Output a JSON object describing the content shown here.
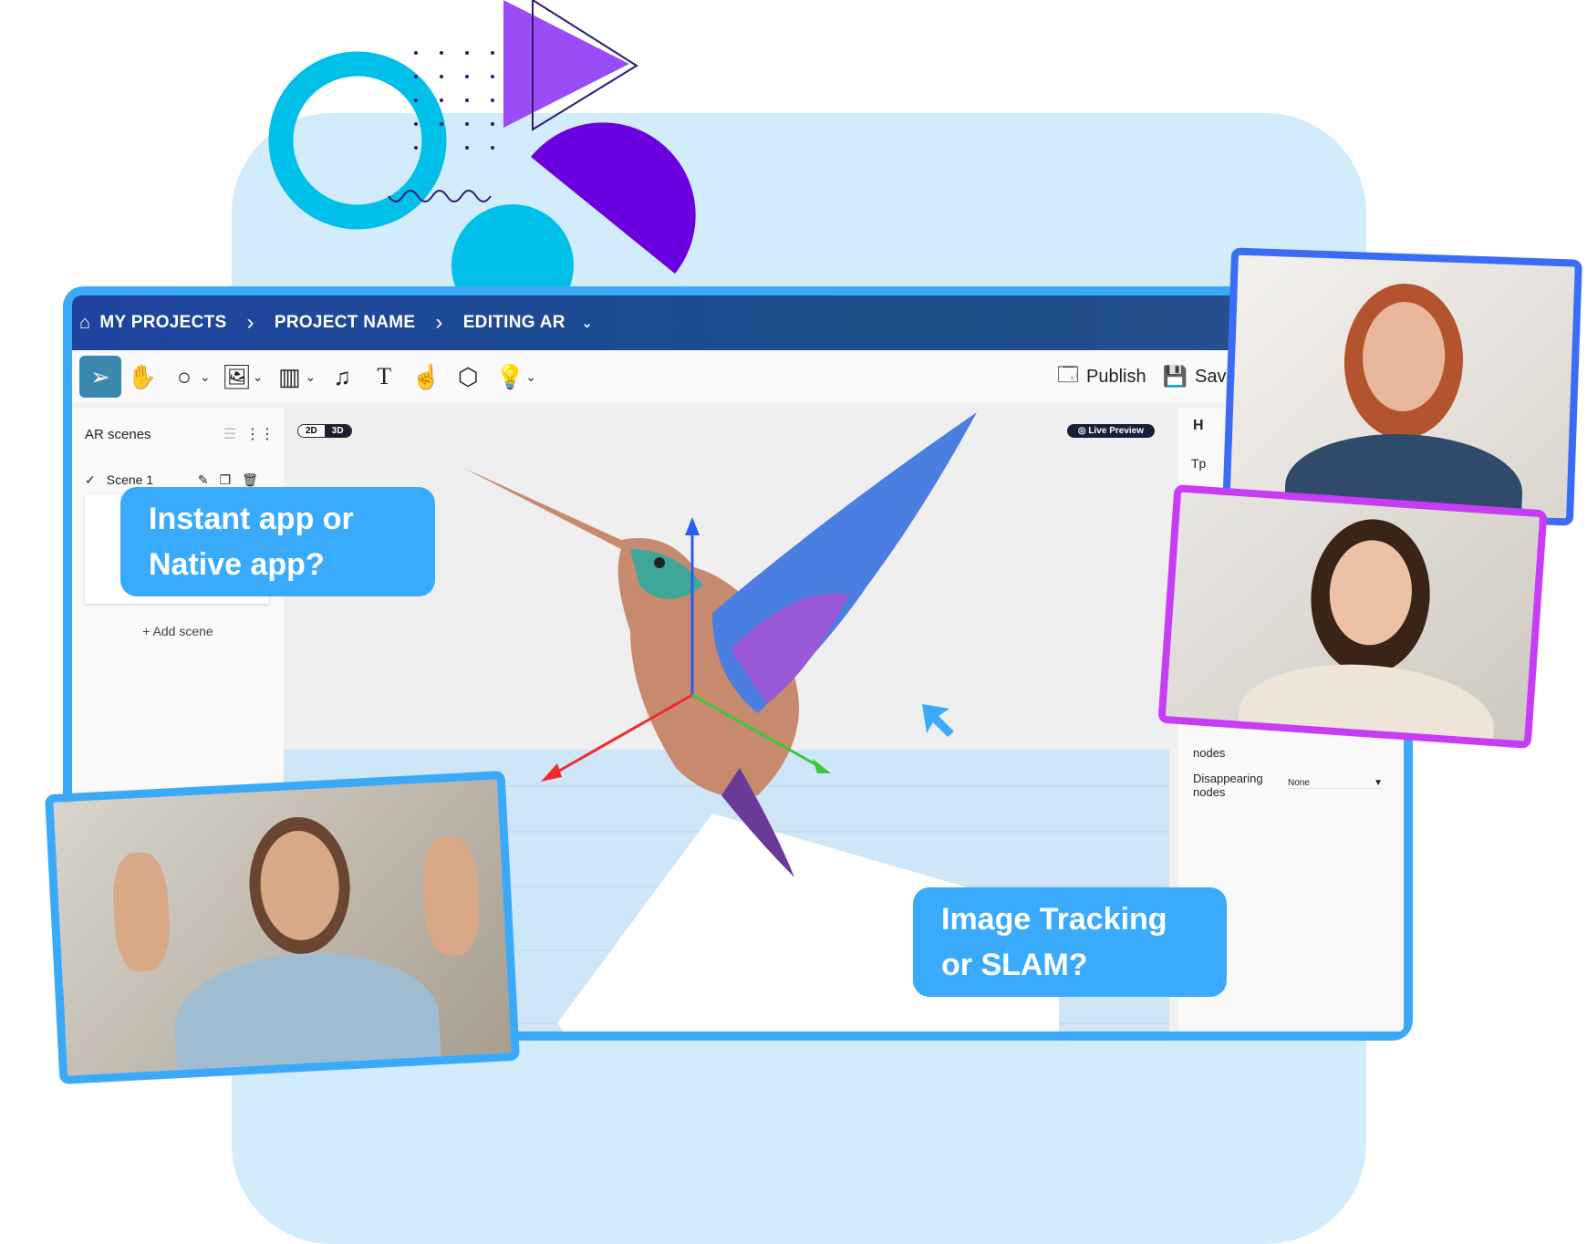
{
  "breadcrumb": {
    "items": [
      "MY PROJECTS",
      "PROJECT NAME",
      "EDITING AR"
    ]
  },
  "toolbar": {
    "publish_label": "Publish",
    "save_label": "Save"
  },
  "scenes_panel": {
    "title": "AR scenes",
    "scenes": [
      {
        "name": "Scene 1"
      }
    ],
    "add_label": "+ Add scene"
  },
  "view_toggle": {
    "options": [
      "2D",
      "3D"
    ],
    "selected": "3D"
  },
  "live_preview_label": "Live Preview",
  "right_panel": {
    "heading_partial": "H",
    "label_partial": "Tp",
    "appearing_partial": "nodes",
    "disappearing_label": "Disappearing nodes",
    "disappearing_value": "None"
  },
  "callouts": {
    "app_type": "Instant app or Native app?",
    "tracking": "Image Tracking or SLAM?"
  },
  "colors": {
    "accent": "#3aa9f8",
    "header": "#1f44a0",
    "callout": "#3aabfc",
    "purple": "#6a00e0",
    "cyan": "#00c0ea",
    "magenta_frame": "#c93cf5",
    "blue_frame": "#3a6cf5"
  }
}
